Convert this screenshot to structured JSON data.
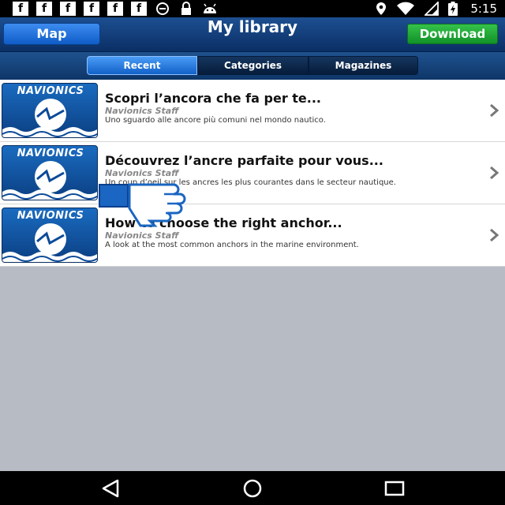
{
  "status_bar": {
    "time": "5:15",
    "notification_icons": [
      "facebook-icon",
      "facebook-icon",
      "facebook-icon",
      "facebook-icon",
      "facebook-icon",
      "facebook-icon",
      "data-saver-icon",
      "lock-icon",
      "android-icon"
    ],
    "system_icons": [
      "location-icon",
      "wifi-icon",
      "signal-icon",
      "battery-charging-icon"
    ]
  },
  "nav": {
    "left_button": "Map",
    "title": "My library",
    "right_button": "Download"
  },
  "tabs": [
    {
      "label": "Recent",
      "selected": true
    },
    {
      "label": "Categories",
      "selected": false
    },
    {
      "label": "Magazines",
      "selected": false
    }
  ],
  "articles": [
    {
      "thumbnail_brand": "NAVIONICS",
      "title": "Scopri l’ancora che fa per te...",
      "author": "Navionics Staff",
      "description": "Uno sguardo alle ancore più comuni nel mondo nautico."
    },
    {
      "thumbnail_brand": "NAVIONICS",
      "title": "Découvrez l’ancre parfaite pour vous...",
      "author": "Navionics Staff",
      "description": "Un coup d’oeil sur les ancres les plus courantes dans le secteur nautique."
    },
    {
      "thumbnail_brand": "NAVIONICS",
      "title": "How to choose the right anchor...",
      "author": "Navionics Staff",
      "description": "A look at the most common anchors in the marine environment."
    }
  ],
  "overlay": {
    "icon": "thumbs-down-icon"
  },
  "colors": {
    "nav_bar": "#0b2f66",
    "map_button": "#1f6fdc",
    "download_button": "#1fa535",
    "selected_tab": "#2a7fe6",
    "page_background": "#b7bcc4"
  },
  "bottom_nav": [
    "back-icon",
    "home-icon",
    "recents-icon"
  ]
}
